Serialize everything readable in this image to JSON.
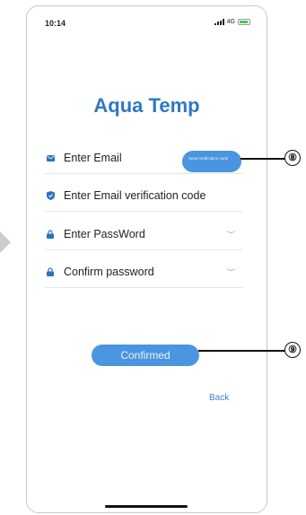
{
  "status_bar": {
    "time": "10:14",
    "network": "4G"
  },
  "app": {
    "title": "Aqua Temp"
  },
  "form": {
    "email": {
      "placeholder": "Enter Email",
      "value": "",
      "send_code_label": "Send verification code"
    },
    "verification_code": {
      "placeholder": "Enter Email verification code",
      "value": ""
    },
    "password": {
      "placeholder": "Enter PassWord",
      "value": ""
    },
    "confirm_password": {
      "placeholder": "Confirm password",
      "value": ""
    },
    "confirm_label": "Confirmed",
    "back_label": "Back"
  },
  "callouts": {
    "send_code_marker": "⑧",
    "confirm_marker": "⑨"
  },
  "colors": {
    "brand": "#2f78c4",
    "button": "#4a95df",
    "icon": "#2f6fbf"
  }
}
